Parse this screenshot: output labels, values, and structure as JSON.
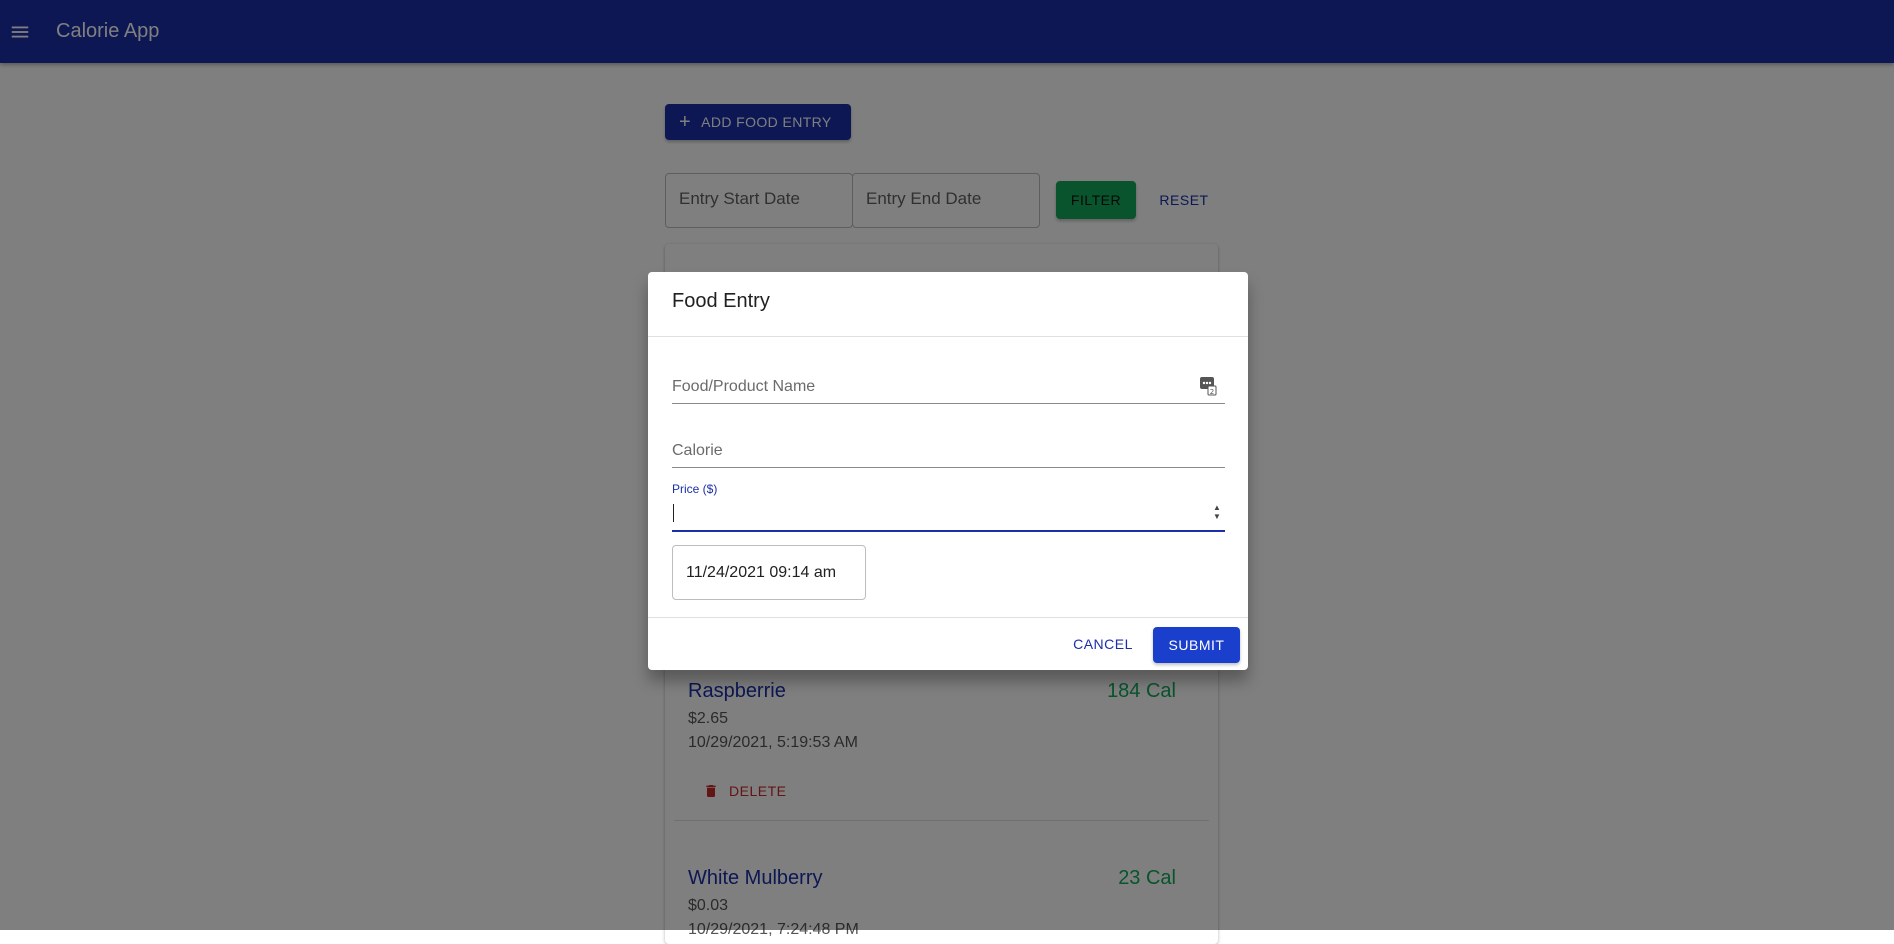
{
  "appbar": {
    "title": "Calorie App",
    "menu_icon": "menu-icon"
  },
  "toolbar": {
    "add_label": "ADD FOOD ENTRY",
    "start_date_placeholder": "Entry Start Date",
    "end_date_placeholder": "Entry End Date",
    "filter_label": "FILTER",
    "reset_label": "RESET"
  },
  "entries": [
    {
      "name": "Raspberrie",
      "calories": "184 Cal",
      "price": "$2.65",
      "date": "10/29/2021, 5:19:53 AM",
      "delete_label": "DELETE"
    },
    {
      "name": "White Mulberry",
      "calories": "23 Cal",
      "price": "$0.03",
      "date": "10/29/2021, 7:24:48 PM"
    }
  ],
  "dialog": {
    "title": "Food Entry",
    "name_label": "Food/Product Name",
    "calorie_label": "Calorie",
    "price_label": "Price ($)",
    "price_value": "",
    "datetime_value": "11/24/2021 09:14 am",
    "cancel_label": "CANCEL",
    "submit_label": "SUBMIT"
  },
  "colors": {
    "primary": "#1a2fa8",
    "success": "#12a85a",
    "danger": "#c62828"
  }
}
